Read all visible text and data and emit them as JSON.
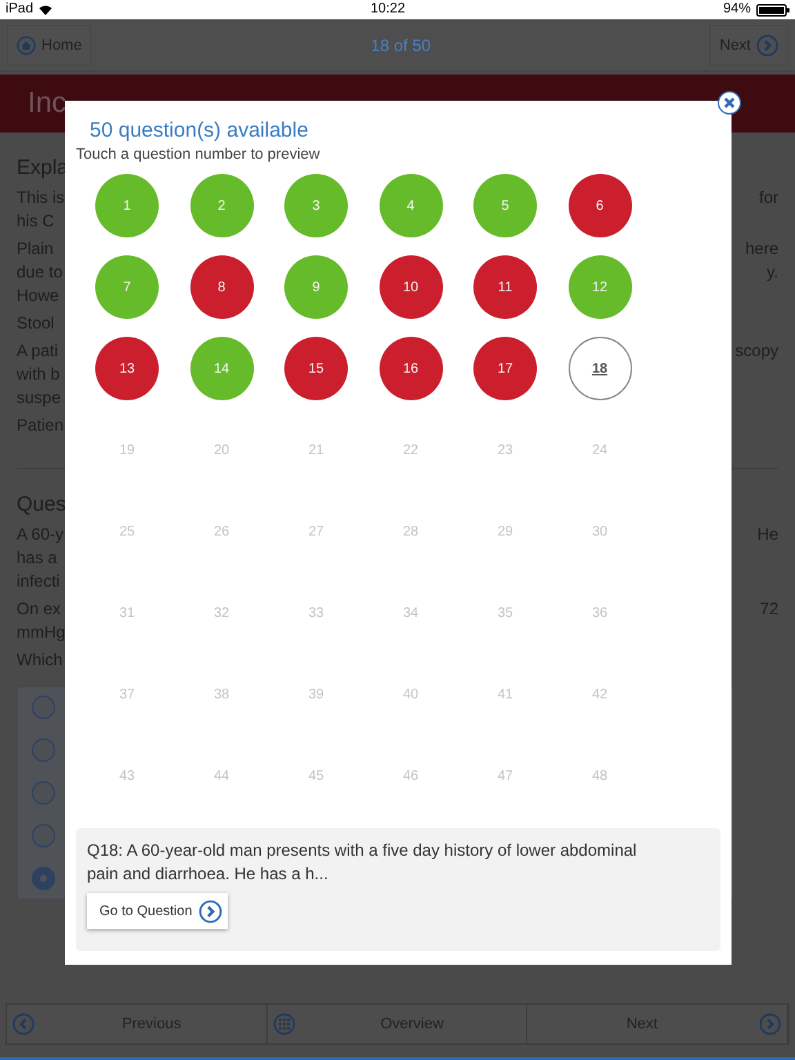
{
  "status_bar": {
    "device": "iPad",
    "time": "10:22",
    "battery": "94%"
  },
  "top_nav": {
    "home": "Home",
    "position": "18 of 50",
    "next": "Next"
  },
  "result_banner": {
    "title": "Inc"
  },
  "explanation": {
    "heading": "Expla",
    "paragraphs": [
      {
        "lines": [
          {
            "start": "This is",
            "end": "for"
          },
          {
            "start": "his C"
          }
        ]
      },
      {
        "lines": [
          {
            "start": "Plain",
            "end": "here"
          },
          {
            "start": "due to",
            "end": "y."
          },
          {
            "start": "Howe"
          }
        ]
      },
      {
        "lines": [
          {
            "start": "Stool"
          }
        ]
      },
      {
        "lines": [
          {
            "start": "A pati",
            "end": "scopy"
          },
          {
            "start": "with b"
          },
          {
            "start": "suspe"
          }
        ]
      },
      {
        "lines": [
          {
            "start": "Patien"
          }
        ]
      }
    ]
  },
  "question": {
    "heading": "Ques",
    "paragraphs": [
      {
        "lines": [
          {
            "start": "A 60-y",
            "end": "He"
          },
          {
            "start": "has a"
          },
          {
            "start": "infecti"
          }
        ]
      },
      {
        "lines": [
          {
            "start": "On ex",
            "end": "72"
          },
          {
            "start": "mmHg"
          }
        ]
      },
      {
        "lines": [
          {
            "start": "Which"
          }
        ]
      }
    ]
  },
  "options": [
    {
      "selected": false
    },
    {
      "selected": false
    },
    {
      "selected": false
    },
    {
      "selected": false
    },
    {
      "selected": true
    }
  ],
  "bottom_nav": {
    "previous": "Previous",
    "overview": "Overview",
    "next": "Next"
  },
  "overview_modal": {
    "title": "50 question(s) available",
    "subtitle": "Touch a question number to preview",
    "questions": [
      {
        "number": "1",
        "answered": true,
        "correct": true,
        "selected": false
      },
      {
        "number": "2",
        "answered": true,
        "correct": true,
        "selected": false
      },
      {
        "number": "3",
        "answered": true,
        "correct": true,
        "selected": false
      },
      {
        "number": "4",
        "answered": true,
        "correct": true,
        "selected": false
      },
      {
        "number": "5",
        "answered": true,
        "correct": true,
        "selected": false
      },
      {
        "number": "6",
        "answered": true,
        "correct": false,
        "selected": false
      },
      {
        "number": "7",
        "answered": true,
        "correct": true,
        "selected": false
      },
      {
        "number": "8",
        "answered": true,
        "correct": false,
        "selected": false
      },
      {
        "number": "9",
        "answered": true,
        "correct": true,
        "selected": false
      },
      {
        "number": "10",
        "answered": true,
        "correct": false,
        "selected": false
      },
      {
        "number": "11",
        "answered": true,
        "correct": false,
        "selected": false
      },
      {
        "number": "12",
        "answered": true,
        "correct": true,
        "selected": false
      },
      {
        "number": "13",
        "answered": true,
        "correct": false,
        "selected": false
      },
      {
        "number": "14",
        "answered": true,
        "correct": true,
        "selected": false
      },
      {
        "number": "15",
        "answered": true,
        "correct": false,
        "selected": false
      },
      {
        "number": "16",
        "answered": true,
        "correct": false,
        "selected": false
      },
      {
        "number": "17",
        "answered": true,
        "correct": false,
        "selected": false
      },
      {
        "number": "18",
        "answered": false,
        "selected": true
      },
      {
        "number": "19",
        "answered": false,
        "selected": false
      },
      {
        "number": "20",
        "answered": false,
        "selected": false
      },
      {
        "number": "21",
        "answered": false,
        "selected": false
      },
      {
        "number": "22",
        "answered": false,
        "selected": false
      },
      {
        "number": "23",
        "answered": false,
        "selected": false
      },
      {
        "number": "24",
        "answered": false,
        "selected": false
      },
      {
        "number": "25",
        "answered": false,
        "selected": false
      },
      {
        "number": "26",
        "answered": false,
        "selected": false
      },
      {
        "number": "27",
        "answered": false,
        "selected": false
      },
      {
        "number": "28",
        "answered": false,
        "selected": false
      },
      {
        "number": "29",
        "answered": false,
        "selected": false
      },
      {
        "number": "30",
        "answered": false,
        "selected": false
      },
      {
        "number": "31",
        "answered": false,
        "selected": false
      },
      {
        "number": "32",
        "answered": false,
        "selected": false
      },
      {
        "number": "33",
        "answered": false,
        "selected": false
      },
      {
        "number": "34",
        "answered": false,
        "selected": false
      },
      {
        "number": "35",
        "answered": false,
        "selected": false
      },
      {
        "number": "36",
        "answered": false,
        "selected": false
      },
      {
        "number": "37",
        "answered": false,
        "selected": false
      },
      {
        "number": "38",
        "answered": false,
        "selected": false
      },
      {
        "number": "39",
        "answered": false,
        "selected": false
      },
      {
        "number": "40",
        "answered": false,
        "selected": false
      },
      {
        "number": "41",
        "answered": false,
        "selected": false
      },
      {
        "number": "42",
        "answered": false,
        "selected": false
      },
      {
        "number": "43",
        "answered": false,
        "selected": false
      },
      {
        "number": "44",
        "answered": false,
        "selected": false
      },
      {
        "number": "45",
        "answered": false,
        "selected": false
      },
      {
        "number": "46",
        "answered": false,
        "selected": false
      },
      {
        "number": "47",
        "answered": false,
        "selected": false
      },
      {
        "number": "48",
        "answered": false,
        "selected": false
      }
    ],
    "preview": {
      "text": "Q18: A 60-year-old man presents with a five day history of lower abdominal pain and diarrhoea. He has a h...",
      "button": "Go to Question"
    }
  }
}
